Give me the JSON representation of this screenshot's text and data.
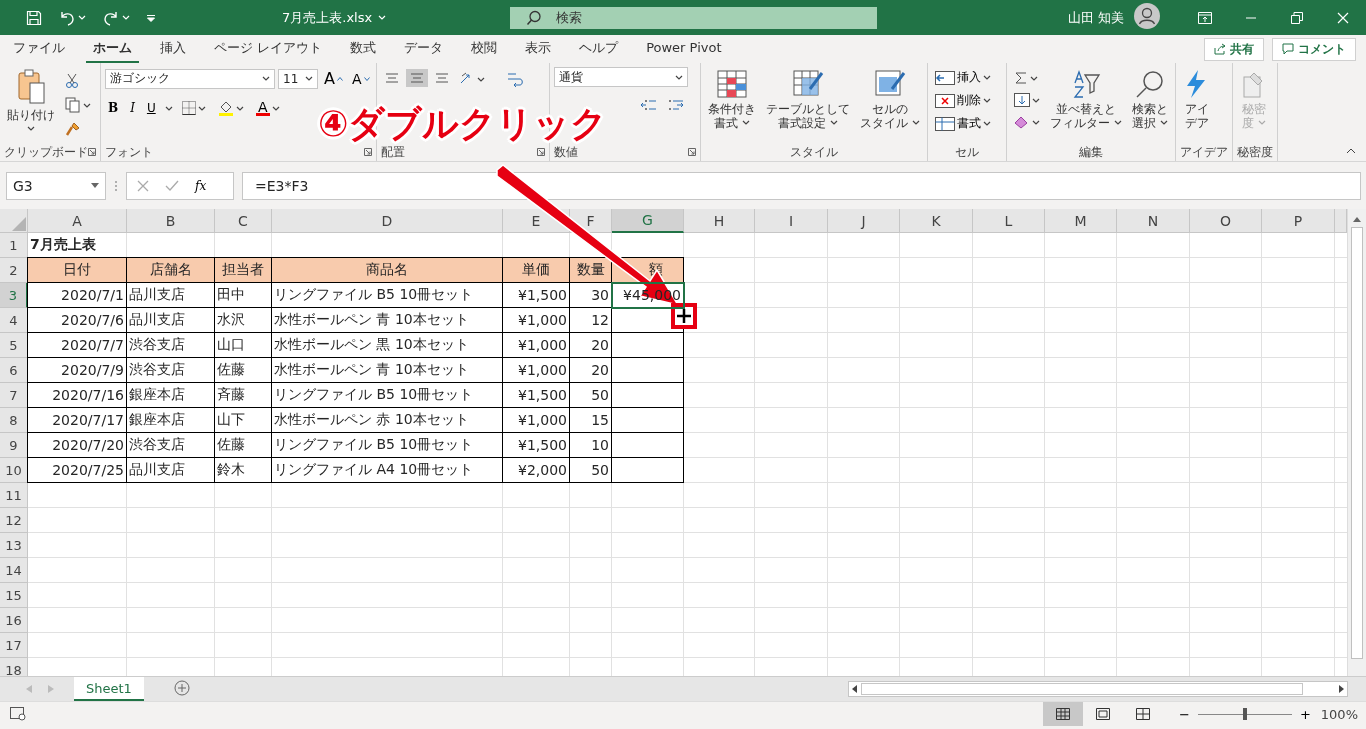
{
  "title_bar": {
    "filename": "7月売上表.xlsx",
    "search_placeholder": "検索",
    "user_name": "山田 知美"
  },
  "menu_tabs": [
    {
      "label": "ファイル",
      "selected": false
    },
    {
      "label": "ホーム",
      "selected": true
    },
    {
      "label": "挿入",
      "selected": false
    },
    {
      "label": "ページ レイアウト",
      "selected": false
    },
    {
      "label": "数式",
      "selected": false
    },
    {
      "label": "データ",
      "selected": false
    },
    {
      "label": "校閲",
      "selected": false
    },
    {
      "label": "表示",
      "selected": false
    },
    {
      "label": "ヘルプ",
      "selected": false
    },
    {
      "label": "Power Pivot",
      "selected": false
    }
  ],
  "share_button": "共有",
  "comment_button": "コメント",
  "ribbon": {
    "clipboard": {
      "label": "クリップボード",
      "paste": "貼り付け"
    },
    "font": {
      "label": "フォント",
      "font_name": "游ゴシック",
      "font_size": "11",
      "grow": "A",
      "shrink": "A",
      "bold": "B",
      "italic": "I",
      "underline": "U",
      "font_color": "A"
    },
    "alignment": {
      "label": "配置"
    },
    "number": {
      "label": "数値",
      "format": "通貨"
    },
    "styles": {
      "label": "スタイル",
      "buttons": [
        {
          "lines": [
            "条件付き",
            "書式"
          ],
          "menu": true
        },
        {
          "lines": [
            "テーブルとして",
            "書式設定"
          ],
          "menu": true
        },
        {
          "lines": [
            "セルの",
            "スタイル"
          ],
          "menu": true
        }
      ]
    },
    "cells": {
      "label": "セル",
      "buttons": [
        "挿入",
        "削除",
        "書式"
      ]
    },
    "editing": {
      "label": "編集",
      "buttons": [
        {
          "lines": [
            "並べ替えと",
            "フィルター"
          ],
          "menu": true
        },
        {
          "lines": [
            "検索と",
            "選択"
          ],
          "menu": true
        }
      ]
    },
    "ideas": {
      "label": "アイデア",
      "button": {
        "lines": [
          "アイ",
          "デア"
        ],
        "menu": false,
        "disabled": false
      }
    },
    "sensitivity": {
      "label": "秘密度",
      "button": {
        "lines": [
          "秘密",
          "度"
        ],
        "menu": true,
        "disabled": true
      }
    }
  },
  "formula_bar": {
    "name_box": "G3",
    "function_button": "fx",
    "formula": "=E3*F3"
  },
  "sheet": {
    "columns": [
      {
        "label": "A",
        "selected": false
      },
      {
        "label": "B",
        "selected": false
      },
      {
        "label": "C",
        "selected": false
      },
      {
        "label": "D",
        "selected": false
      },
      {
        "label": "E",
        "selected": false
      },
      {
        "label": "F",
        "selected": false
      },
      {
        "label": "G",
        "selected": true
      },
      {
        "label": "H",
        "selected": false
      },
      {
        "label": "I",
        "selected": false
      },
      {
        "label": "J",
        "selected": false
      },
      {
        "label": "K",
        "selected": false
      },
      {
        "label": "L",
        "selected": false
      },
      {
        "label": "M",
        "selected": false
      },
      {
        "label": "N",
        "selected": false
      },
      {
        "label": "O",
        "selected": false
      },
      {
        "label": "P",
        "selected": false
      }
    ],
    "rows": [
      {
        "number": "1",
        "selected": false,
        "kind": "title",
        "cells": [
          "7月売上表"
        ]
      },
      {
        "number": "2",
        "selected": false,
        "kind": "header",
        "cells": [
          "日付",
          "店舗名",
          "担当者",
          "商品名",
          "単価",
          "数量",
          "額"
        ]
      },
      {
        "number": "3",
        "selected": true,
        "kind": "data",
        "cells": [
          "2020/7/1",
          "品川支店",
          "田中",
          "リングファイル B5 10冊セット",
          "¥1,500",
          "30",
          "¥45,000"
        ]
      },
      {
        "number": "4",
        "selected": false,
        "kind": "data",
        "cells": [
          "2020/7/6",
          "品川支店",
          "水沢",
          "水性ボールペン 青 10本セット",
          "¥1,000",
          "12",
          null
        ]
      },
      {
        "number": "5",
        "selected": false,
        "kind": "data",
        "cells": [
          "2020/7/7",
          "渋谷支店",
          "山口",
          "水性ボールペン 黒 10本セット",
          "¥1,000",
          "20",
          null
        ]
      },
      {
        "number": "6",
        "selected": false,
        "kind": "data",
        "cells": [
          "2020/7/9",
          "渋谷支店",
          "佐藤",
          "水性ボールペン 青 10本セット",
          "¥1,000",
          "20",
          null
        ]
      },
      {
        "number": "7",
        "selected": false,
        "kind": "data",
        "cells": [
          "2020/7/16",
          "銀座本店",
          "斉藤",
          "リングファイル B5 10冊セット",
          "¥1,500",
          "50",
          null
        ]
      },
      {
        "number": "8",
        "selected": false,
        "kind": "data",
        "cells": [
          "2020/7/17",
          "銀座本店",
          "山下",
          "水性ボールペン 赤 10本セット",
          "¥1,000",
          "15",
          null
        ]
      },
      {
        "number": "9",
        "selected": false,
        "kind": "data",
        "cells": [
          "2020/7/20",
          "渋谷支店",
          "佐藤",
          "リングファイル B5 10冊セット",
          "¥1,500",
          "10",
          null
        ]
      },
      {
        "number": "10",
        "selected": false,
        "kind": "data",
        "cells": [
          "2020/7/25",
          "品川支店",
          "鈴木",
          "リングファイル A4 10冊セット",
          "¥2,000",
          "50",
          null
        ]
      },
      {
        "number": "11",
        "selected": false,
        "kind": "empty"
      },
      {
        "number": "12",
        "selected": false,
        "kind": "empty"
      },
      {
        "number": "13",
        "selected": false,
        "kind": "empty"
      },
      {
        "number": "14",
        "selected": false,
        "kind": "empty"
      },
      {
        "number": "15",
        "selected": false,
        "kind": "empty"
      },
      {
        "number": "16",
        "selected": false,
        "kind": "empty"
      },
      {
        "number": "17",
        "selected": false,
        "kind": "empty"
      },
      {
        "number": "18",
        "selected": false,
        "kind": "empty"
      }
    ]
  },
  "sheet_tabs": [
    {
      "label": "Sheet1",
      "selected": true
    }
  ],
  "status_bar": {
    "views": [
      {
        "kind": "normal",
        "selected": true
      },
      {
        "kind": "page_layout",
        "selected": false
      },
      {
        "kind": "page_break",
        "selected": false
      }
    ],
    "zoom_out": "−",
    "zoom_in": "+",
    "zoom_level": {
      "level": 0.5
    },
    "zoom": "100%"
  },
  "annotation": {
    "text": "④ダブルクリック"
  }
}
